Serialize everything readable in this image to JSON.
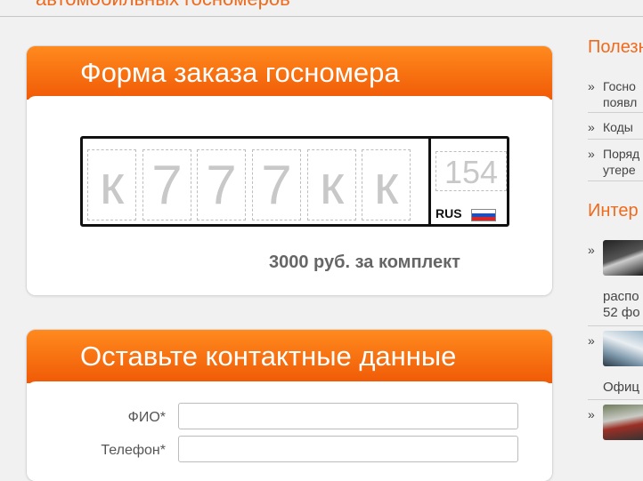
{
  "header": {
    "title": "автомобильных госномеров"
  },
  "order_form": {
    "title": "Форма заказа госномера",
    "plate_chars": [
      "к",
      "7",
      "7",
      "7",
      "к",
      "к"
    ],
    "region": "154",
    "country": "RUS",
    "price": "3000 руб. за комплект"
  },
  "contact_form": {
    "title": "Оставьте контактные данные",
    "fio_label": "ФИО*",
    "fio_value": "",
    "phone_label": "Телефон*",
    "phone_value": ""
  },
  "sidebar": {
    "useful_heading": "Полезн",
    "useful_items": [
      {
        "line1": "Госно",
        "line2": "появл"
      },
      {
        "line1": "Коды",
        "line2": ""
      },
      {
        "line1": "Поряд",
        "line2": "утере"
      }
    ],
    "interesting_heading": "Интер",
    "interesting_items": [
      {
        "caption1": "распо",
        "caption2": "52 фо"
      },
      {
        "caption1": "Офиц",
        "caption2": ""
      },
      {
        "caption1": "",
        "caption2": ""
      }
    ],
    "bullet": "»"
  },
  "colors": {
    "accent": "#f06a1c",
    "header_gradient_top": "#ff8a1e",
    "header_gradient_bottom": "#f05a06"
  }
}
